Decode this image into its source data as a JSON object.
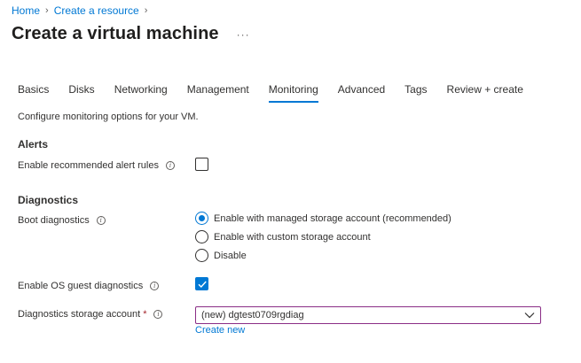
{
  "breadcrumb": {
    "home": "Home",
    "create_resource": "Create a resource"
  },
  "header": {
    "title": "Create a virtual machine",
    "more": "···"
  },
  "tabs": [
    {
      "label": "Basics"
    },
    {
      "label": "Disks"
    },
    {
      "label": "Networking"
    },
    {
      "label": "Management"
    },
    {
      "label": "Monitoring",
      "active": true
    },
    {
      "label": "Advanced"
    },
    {
      "label": "Tags"
    },
    {
      "label": "Review + create"
    }
  ],
  "intro": "Configure monitoring options for your VM.",
  "alerts": {
    "heading": "Alerts",
    "recommended_rules_label": "Enable recommended alert rules",
    "recommended_rules_checked": false
  },
  "diagnostics": {
    "heading": "Diagnostics",
    "boot_label": "Boot diagnostics",
    "boot_options": [
      "Enable with managed storage account (recommended)",
      "Enable with custom storage account",
      "Disable"
    ],
    "boot_selected": "Enable with managed storage account (recommended)",
    "os_guest_label": "Enable OS guest diagnostics",
    "os_guest_checked": true,
    "storage_label": "Diagnostics storage account",
    "storage_required": "*",
    "storage_value": "(new) dgtest0709rgdiag",
    "create_new": "Create new"
  },
  "icons": {
    "info": "info-icon",
    "chevron": "chevron-down-icon",
    "checkmark": "checkmark-icon"
  },
  "colors": {
    "accent": "#0078d4",
    "focus_border": "#8a2d86",
    "required": "#a4262c"
  }
}
